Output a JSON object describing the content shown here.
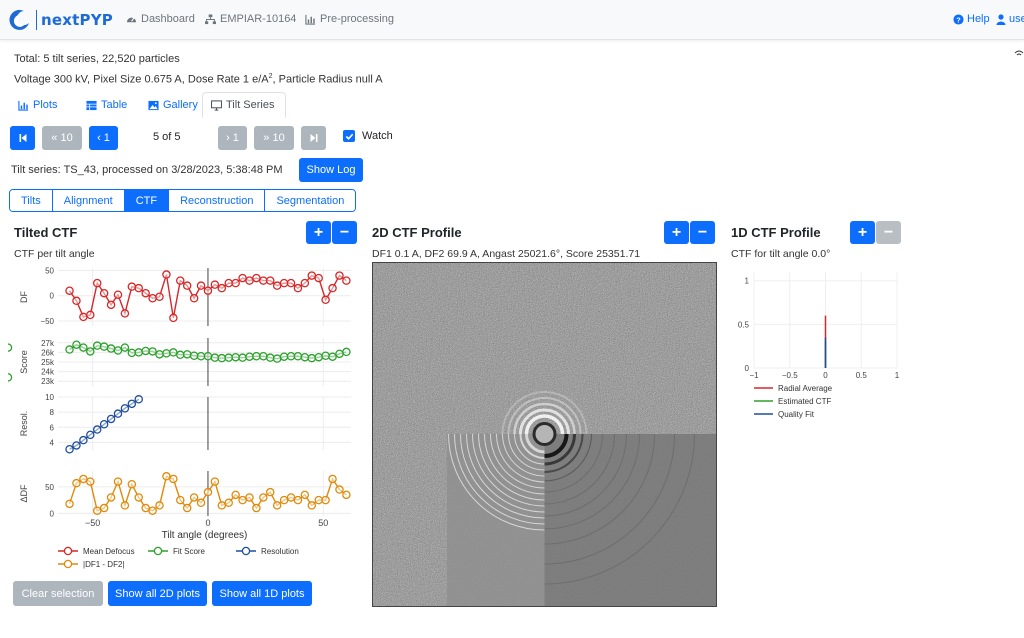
{
  "brand": {
    "name": "nextPYP"
  },
  "nav": {
    "dashboard": "Dashboard",
    "project": "EMPIAR-10164",
    "block": "Pre-processing",
    "help": "Help",
    "user": "use"
  },
  "summary": {
    "totals": "Total: 5 tilt series, 22,520 particles",
    "params_pre": "Voltage 300 kV, Pixel Size 0.675 A, Dose Rate 1 e/A",
    "params_sup": "2",
    "params_post": ", Particle Radius null A"
  },
  "tabs": [
    {
      "label": "Plots",
      "icon": "bar-chart-icon"
    },
    {
      "label": "Table",
      "icon": "table-icon"
    },
    {
      "label": "Gallery",
      "icon": "image-icon"
    },
    {
      "label": "Tilt Series",
      "icon": "monitor-icon",
      "active": true
    }
  ],
  "pager": {
    "first": "|◀",
    "back10": "« 10",
    "back1": "‹ 1",
    "count": "5 of 5",
    "fwd1": "› 1",
    "fwd10": "» 10",
    "last": "▶|",
    "watch_label": "Watch",
    "watch_checked": true
  },
  "tilt_series": {
    "info": "Tilt series: TS_43, processed on 3/28/2023, 5:38:48 PM",
    "show_log": "Show Log"
  },
  "subtabs": [
    "Tilts",
    "Alignment",
    "CTF",
    "Reconstruction",
    "Segmentation"
  ],
  "subtab_active": "CTF",
  "tilted_ctf": {
    "title": "Tilted CTF",
    "subtitle": "CTF per tilt angle",
    "plus": "+",
    "minus": "−",
    "xlabel": "Tilt angle (degrees)",
    "legend": [
      {
        "name": "Mean Defocus",
        "color": "#d62728"
      },
      {
        "name": "Fit Score",
        "color": "#2ca02c"
      },
      {
        "name": "Resolution",
        "color": "#1f4e9c"
      },
      {
        "name": "|DF1 - DF2|",
        "color": "#e08a0b"
      }
    ]
  },
  "ctf2d": {
    "title": "2D CTF Profile",
    "subtitle": "DF1 0.1 A, DF2 69.9 A, Angast 25021.6°, Score 25351.71",
    "plus": "+",
    "minus": "−"
  },
  "ctf1d": {
    "title": "1D CTF Profile",
    "subtitle": "CTF for tilt angle 0.0°",
    "plus": "+",
    "minus": "−",
    "legend": [
      {
        "name": "Radial Average",
        "color": "#d62728"
      },
      {
        "name": "Estimated CTF",
        "color": "#2ca02c"
      },
      {
        "name": "Quality Fit",
        "color": "#1f4e9c"
      }
    ]
  },
  "buttons": {
    "clear_selection": "Clear selection",
    "show_2d": "Show all 2D plots",
    "show_1d": "Show all 1D plots"
  },
  "chart_data": [
    {
      "type": "line",
      "title": "",
      "xlabel": "Tilt angle (degrees)",
      "xlim": [
        -65,
        62
      ],
      "xticks": [
        -50,
        0,
        50
      ],
      "x": [
        -60,
        -57,
        -54,
        -51,
        -48,
        -45,
        -42,
        -39,
        -36,
        -33,
        -30,
        -27,
        -24,
        -21,
        -18,
        -15,
        -12,
        -9,
        -6,
        -3,
        0,
        3,
        6,
        9,
        12,
        15,
        18,
        21,
        24,
        27,
        30,
        33,
        36,
        39,
        42,
        45,
        48,
        51,
        54,
        57,
        60
      ],
      "subplots": [
        {
          "ylabel": "DF",
          "ylim": [
            -60,
            55
          ],
          "yticks": [
            -50,
            0,
            50
          ],
          "series": [
            {
              "name": "Mean Defocus",
              "values": [
                10,
                -10,
                -42,
                -38,
                25,
                5,
                -18,
                2,
                -35,
                18,
                15,
                5,
                -5,
                -2,
                42,
                -44,
                30,
                20,
                -5,
                20,
                10,
                22,
                15,
                25,
                25,
                35,
                30,
                35,
                30,
                30,
                20,
                25,
                25,
                15,
                25,
                40,
                35,
                -8,
                15,
                40,
                30
              ]
            }
          ]
        },
        {
          "ylabel": "Score",
          "ylim": [
            22500,
            27500
          ],
          "yticks": [
            23000,
            24000,
            25000,
            26000,
            27000
          ],
          "series": [
            {
              "name": "Fit Score",
              "values": [
                26300,
                26800,
                26500,
                26100,
                26700,
                26600,
                26400,
                26200,
                26500,
                25950,
                26000,
                26150,
                26100,
                25800,
                25900,
                26000,
                25750,
                25800,
                25650,
                25600,
                25600,
                25450,
                25400,
                25450,
                25500,
                25450,
                25550,
                25600,
                25600,
                25450,
                25350,
                25550,
                25600,
                25600,
                25500,
                25400,
                25500,
                25650,
                25550,
                25850,
                26050,
                23400,
                26500
              ]
            }
          ]
        },
        {
          "ylabel": "Resol.",
          "ylim": [
            3,
            10
          ],
          "yticks": [
            4,
            6,
            8,
            10
          ],
          "series": [
            {
              "name": "Resolution",
              "x": [
                -60,
                -57,
                -54,
                -51,
                -48,
                -45,
                -42,
                -39,
                -36,
                -33,
                -30
              ],
              "values": [
                3.1,
                3.6,
                4.3,
                5.0,
                5.7,
                6.4,
                7.1,
                7.8,
                8.5,
                9.1,
                9.7
              ]
            }
          ]
        },
        {
          "ylabel": "ΔDF",
          "ylim": [
            -5,
            80
          ],
          "yticks": [
            0,
            50
          ],
          "series": [
            {
              "name": "|DF1 - DF2|",
              "values": [
                18,
                57,
                65,
                60,
                5,
                10,
                30,
                60,
                15,
                55,
                30,
                10,
                5,
                15,
                70,
                65,
                25,
                10,
                30,
                20,
                40,
                60,
                15,
                20,
                35,
                25,
                30,
                10,
                30,
                40,
                15,
                25,
                30,
                25,
                35,
                15,
                25,
                25,
                65,
                45,
                35
              ]
            }
          ]
        }
      ]
    },
    {
      "type": "line",
      "title": "",
      "xlim": [
        -1,
        1
      ],
      "xticks": [
        -1,
        -0.5,
        0,
        0.5,
        1
      ],
      "ylim": [
        0,
        1.1
      ],
      "yticks": [
        0,
        0.5,
        1
      ],
      "series": [
        {
          "name": "Radial Average",
          "x": [
            0,
            0
          ],
          "values": [
            0,
            0.6
          ]
        },
        {
          "name": "Estimated CTF",
          "x": [
            0,
            0
          ],
          "values": [
            0,
            0.3
          ]
        },
        {
          "name": "Quality Fit",
          "x": [
            0,
            0
          ],
          "values": [
            0,
            0.35
          ]
        }
      ]
    }
  ]
}
